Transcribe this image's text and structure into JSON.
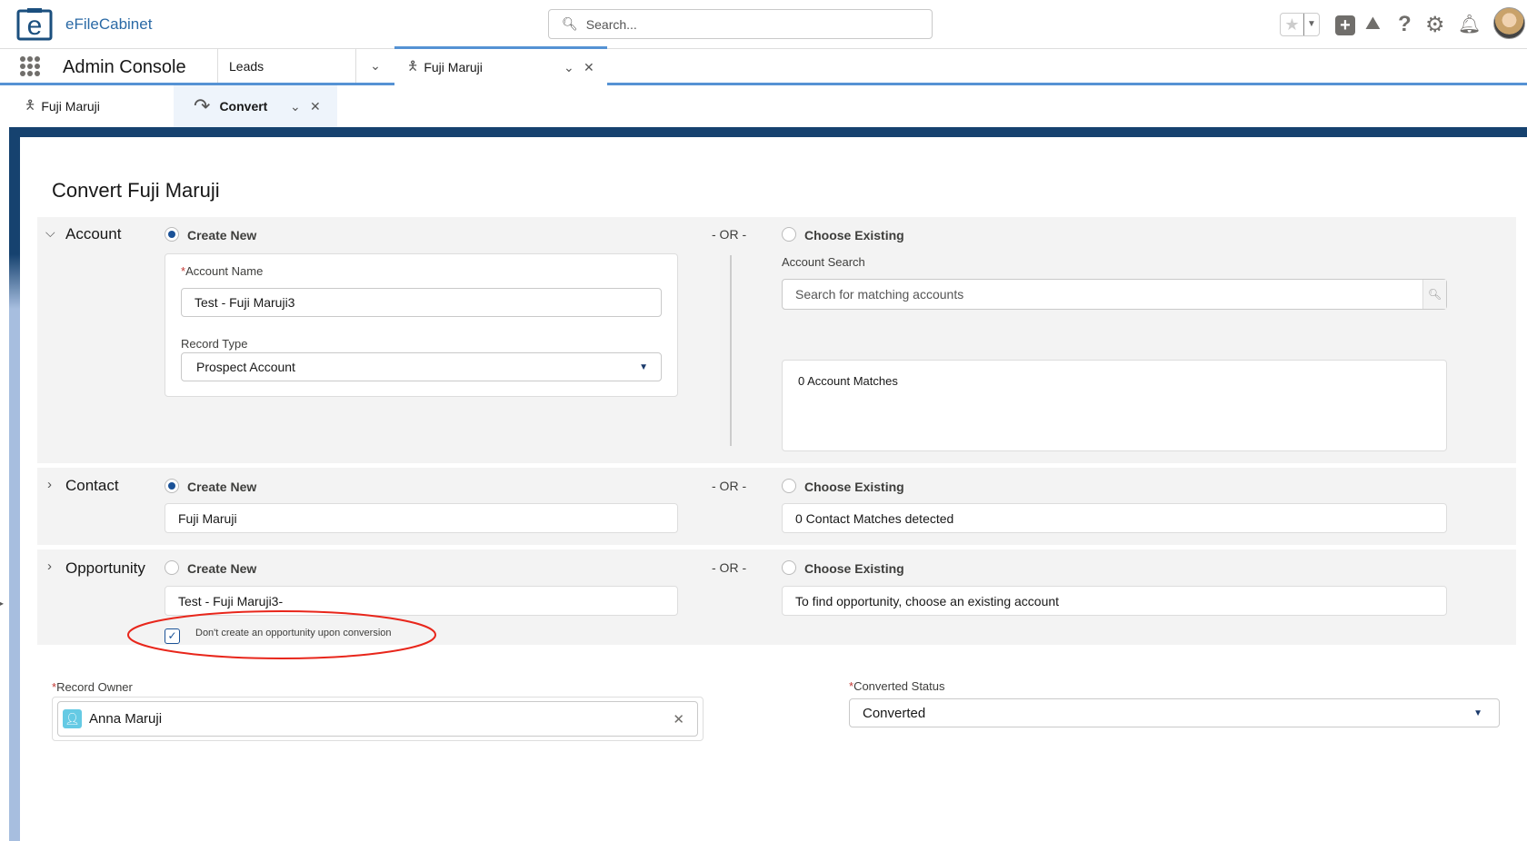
{
  "header": {
    "logo_text": "eFileCabinet",
    "search_placeholder": "Search..."
  },
  "nav": {
    "app_name": "Admin Console",
    "tabs": [
      {
        "label": "Leads"
      },
      {
        "label": "Fuji Maruji"
      }
    ]
  },
  "subtabs": [
    {
      "label": "Fuji Maruji"
    },
    {
      "label": "Convert"
    }
  ],
  "page": {
    "title": "Convert Fuji Maruji",
    "or_label": "- OR -"
  },
  "account": {
    "label": "Account",
    "create_new": "Create New",
    "choose_existing": "Choose Existing",
    "account_name_label": "Account Name",
    "account_name_value": "Test - Fuji Maruji3",
    "record_type_label": "Record Type",
    "record_type_value": "Prospect Account",
    "search_label": "Account Search",
    "search_placeholder": "Search for matching accounts",
    "matches": "0 Account Matches"
  },
  "contact": {
    "label": "Contact",
    "create_new": "Create New",
    "choose_existing": "Choose Existing",
    "value": "Fuji Maruji",
    "matches": "0 Contact Matches detected"
  },
  "opportunity": {
    "label": "Opportunity",
    "create_new": "Create New",
    "choose_existing": "Choose Existing",
    "value": "Test - Fuji Maruji3-",
    "existing_hint": "To find opportunity, choose an existing account",
    "dont_create_label": "Don't create an opportunity upon conversion",
    "dont_create_checked": true
  },
  "owner": {
    "label": "Record Owner",
    "value": "Anna Maruji"
  },
  "status": {
    "label": "Converted Status",
    "value": "Converted"
  },
  "colors": {
    "brand": "#16426f",
    "accent": "#1b5297",
    "annotation": "#e8261b"
  }
}
